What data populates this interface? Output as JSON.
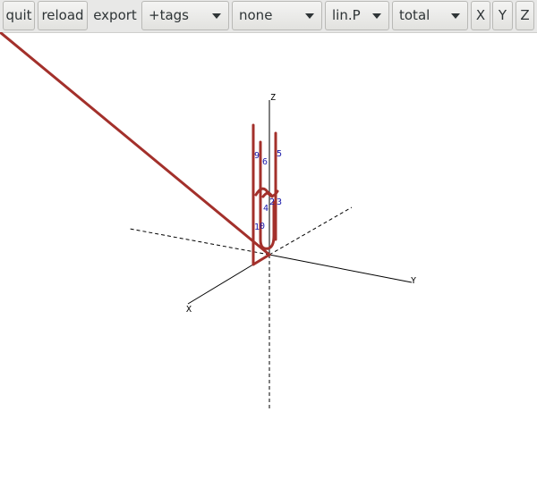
{
  "toolbar": {
    "quit_label": "quit",
    "reload_label": "reload",
    "export_label": "export",
    "tags_select": "+tags",
    "none_select": "none",
    "scale_select": "lin.P",
    "total_select": "total",
    "x_label": "X",
    "y_label": "Y",
    "z_label": "Z"
  },
  "icons": {
    "dropdown": "chevron-down-icon"
  },
  "colors": {
    "curve": "#a3302b",
    "tag_text": "#1515a8",
    "axis": "#000000"
  },
  "plot": {
    "axis_labels": {
      "x": "X",
      "y": "Y",
      "z": "Z"
    },
    "tags": [
      "9",
      "6",
      "5",
      "2",
      "4",
      "3",
      "1",
      "0"
    ]
  }
}
